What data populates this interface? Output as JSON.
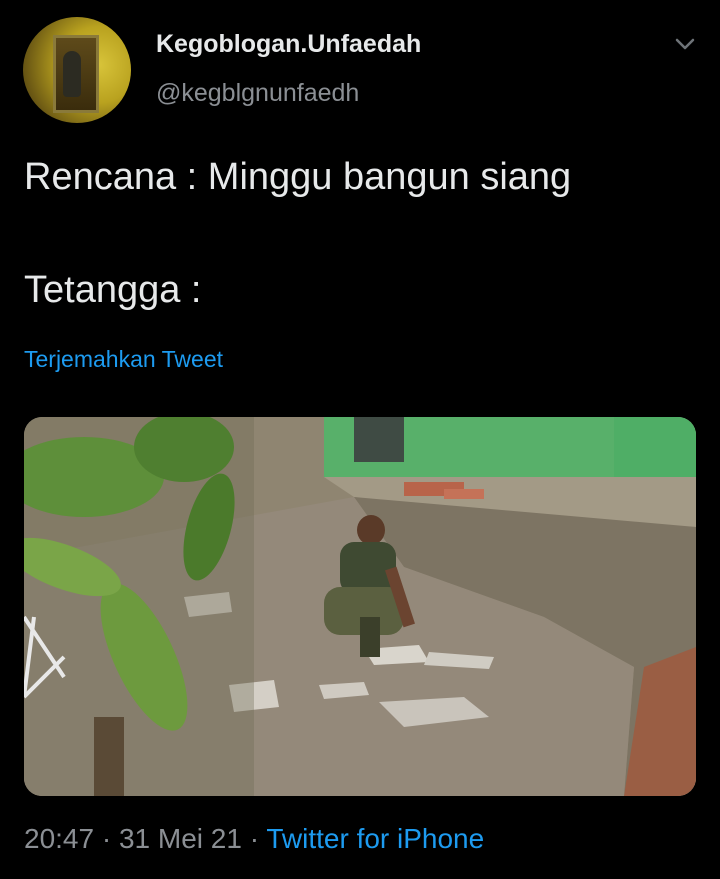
{
  "tweet": {
    "author_name": "Kegoblogan.Unfaedah",
    "author_handle": "@kegblgnunfaedh",
    "text_line1": "Rencana : Minggu bangun siang",
    "text_line2": "Tetangga :",
    "translate_label": "Terjemahkan Tweet",
    "time": "20:47",
    "separator": "·",
    "date": "31 Mei 21",
    "source": "Twitter for iPhone"
  },
  "icons": {
    "menu": "chevron-down-icon",
    "avatar": "profile-avatar"
  },
  "colors": {
    "background": "#000000",
    "text": "#e7e9ea",
    "secondary": "#8b8f94",
    "link": "#1d9bf0"
  }
}
